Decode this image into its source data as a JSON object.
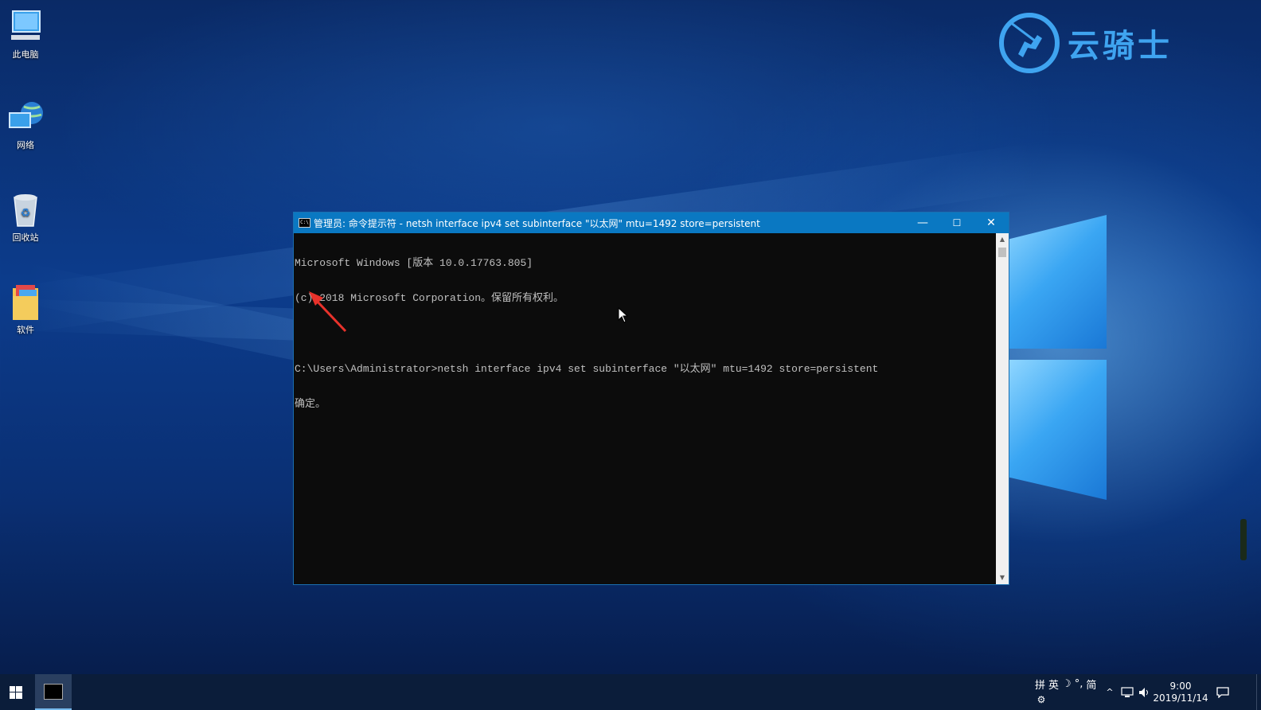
{
  "desktop": {
    "icons": [
      {
        "label": "此电脑",
        "icon": "computer-icon"
      },
      {
        "label": "网络",
        "icon": "network-icon"
      },
      {
        "label": "回收站",
        "icon": "recycle-bin-icon"
      },
      {
        "label": "软件",
        "icon": "folder-icon"
      }
    ],
    "watermark": "云骑士"
  },
  "cmd_window": {
    "title": "管理员: 命令提示符 - netsh  interface ipv4 set subinterface \"以太网\" mtu=1492 store=persistent",
    "icon_text": "C:\\",
    "controls": {
      "minimize": "—",
      "maximize": "☐",
      "close": "✕"
    },
    "lines": [
      "Microsoft Windows [版本 10.0.17763.805]",
      "(c) 2018 Microsoft Corporation。保留所有权利。",
      "",
      "C:\\Users\\Administrator>netsh interface ipv4 set subinterface \"以太网\" mtu=1492 store=persistent",
      "确定。"
    ]
  },
  "taskbar": {
    "start_icon": "windows-logo-icon",
    "ime": [
      "拼",
      "英",
      "☽",
      "°,",
      "简"
    ],
    "clock_time": "9:00",
    "clock_date": "2019/11/14"
  },
  "colors": {
    "titlebar": "#0a78c2",
    "console_bg": "#0c0c0c",
    "console_text": "#c0c0c0",
    "annotation_arrow": "#e8322b",
    "taskbar": "#0b1d3a"
  }
}
